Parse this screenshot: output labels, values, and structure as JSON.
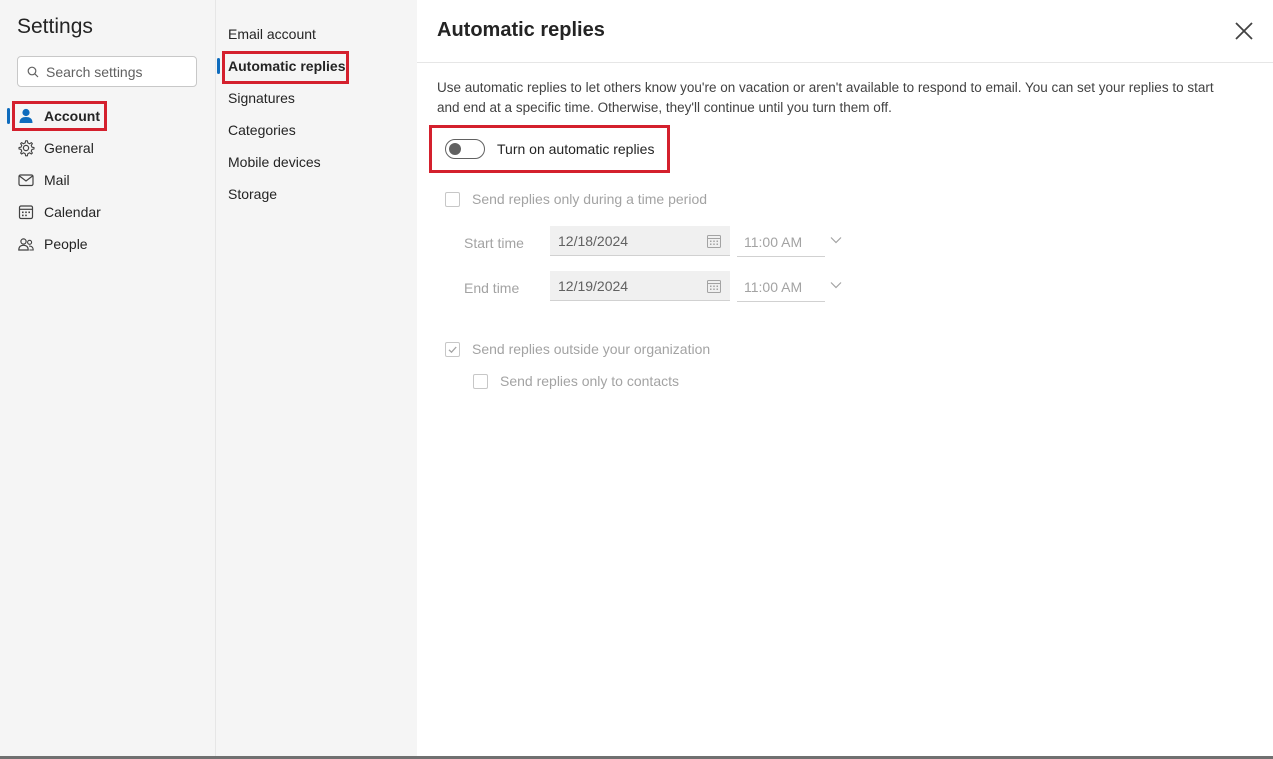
{
  "sidebar": {
    "title": "Settings",
    "search_placeholder": "Search settings",
    "items": [
      {
        "label": "Account",
        "icon": "person-icon"
      },
      {
        "label": "General",
        "icon": "gear-icon"
      },
      {
        "label": "Mail",
        "icon": "mail-icon"
      },
      {
        "label": "Calendar",
        "icon": "calendar-icon"
      },
      {
        "label": "People",
        "icon": "people-icon"
      }
    ]
  },
  "submenu": {
    "items": [
      {
        "label": "Email account"
      },
      {
        "label": "Automatic replies"
      },
      {
        "label": "Signatures"
      },
      {
        "label": "Categories"
      },
      {
        "label": "Mobile devices"
      },
      {
        "label": "Storage"
      }
    ]
  },
  "panel": {
    "title": "Automatic replies",
    "description": "Use automatic replies to let others know you're on vacation or aren't available to respond to email. You can set your replies to start and end at a specific time. Otherwise, they'll continue until you turn them off.",
    "toggle_label": "Turn on automatic replies",
    "toggle_on": false,
    "time_period_label": "Send replies only during a time period",
    "start_label": "Start time",
    "start_date": "12/18/2024",
    "start_time": "11:00 AM",
    "end_label": "End time",
    "end_date": "12/19/2024",
    "end_time": "11:00 AM",
    "outside_org_label": "Send replies outside your organization",
    "outside_org_checked": true,
    "contacts_only_label": "Send replies only to contacts"
  },
  "colors": {
    "accent": "#0f6cbd",
    "highlight_box": "#d4202d"
  }
}
